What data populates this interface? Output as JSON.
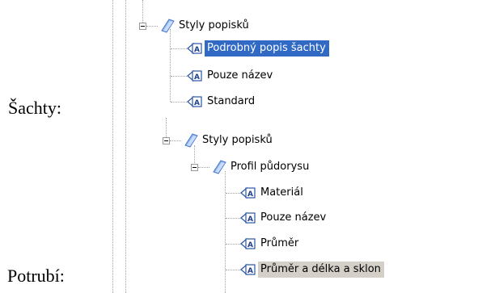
{
  "captions": {
    "shachty": "Šachty:",
    "potrubi": "Potrubí:"
  },
  "tree_top": {
    "root_label": "Styly popisků",
    "items": [
      {
        "label": "Podrobný popis šachty",
        "state": "selected"
      },
      {
        "label": "Pouze název",
        "state": "normal"
      },
      {
        "label": "Standard",
        "state": "normal"
      }
    ]
  },
  "tree_bottom": {
    "root_label": "Styly popisků",
    "group_label": "Profil půdorysu",
    "items": [
      {
        "label": "Materiál",
        "state": "normal"
      },
      {
        "label": "Pouze název",
        "state": "normal"
      },
      {
        "label": "Průměr",
        "state": "normal"
      },
      {
        "label": "Průměr a délka a sklon",
        "state": "inactive-selected"
      }
    ]
  },
  "icons": {
    "folder": "folder-icon",
    "label_style": "label-style-icon",
    "expander": "collapse-minus-icon"
  },
  "colors": {
    "selection": "#316ac5",
    "inactive_selection": "#d4d0c8",
    "tree_lines": "#a0a0a0"
  }
}
